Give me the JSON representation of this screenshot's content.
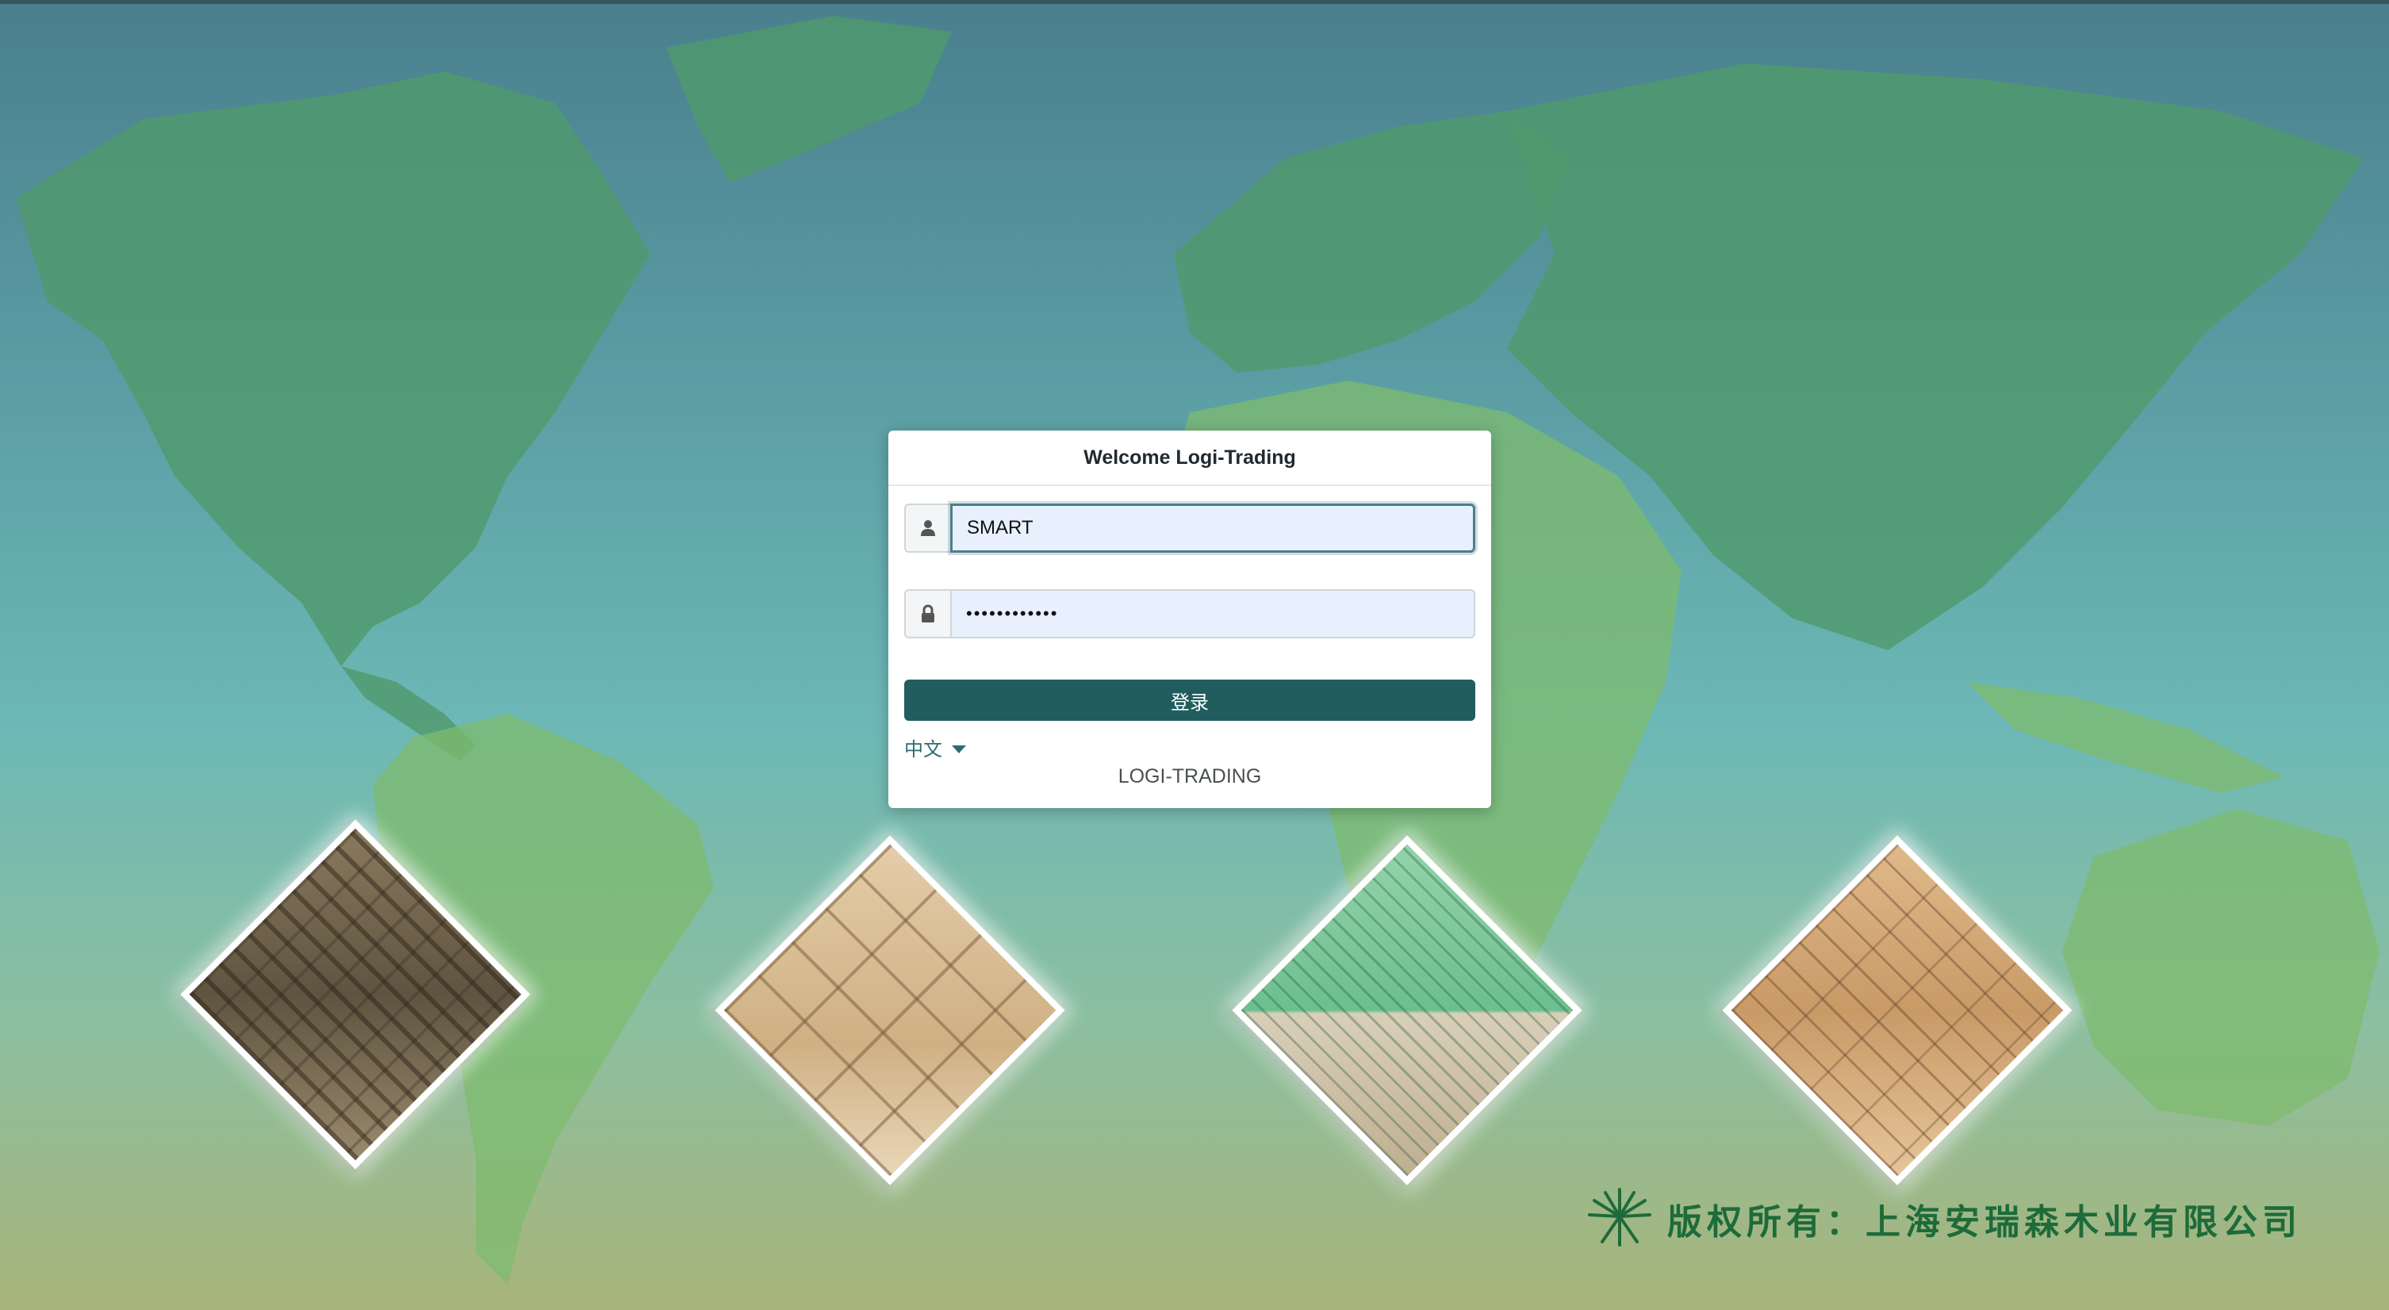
{
  "login": {
    "title": "Welcome Logi-Trading",
    "username_value": "SMART",
    "password_value": "••••••••••••",
    "submit_label": "登录",
    "language": "中文",
    "brand": "LOGI-TRADING"
  },
  "footer": {
    "copyright": "版权所有：上海安瑞森木业有限公司"
  },
  "icons": {
    "user": "user-icon",
    "lock": "lock-icon",
    "caret": "caret-down-icon",
    "logo": "company-logo-icon"
  },
  "colors": {
    "primary_button": "#215d5e",
    "copyright_green": "#1e6b3a",
    "input_fill": "#e8f0fe"
  }
}
